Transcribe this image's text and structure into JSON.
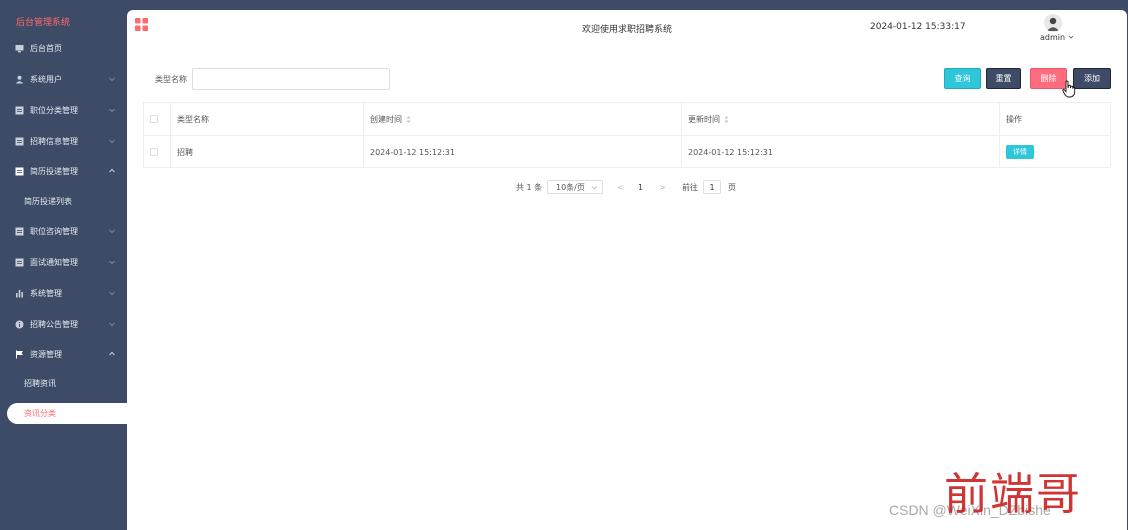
{
  "sidebar": {
    "title": "后台管理系统",
    "items": [
      {
        "label": "后台首页",
        "icon": "monitor-icon"
      },
      {
        "label": "系统用户",
        "icon": "user-icon"
      },
      {
        "label": "职位分类管理",
        "icon": "list-icon"
      },
      {
        "label": "招聘信息管理",
        "icon": "list-icon"
      },
      {
        "label": "简历投递管理",
        "icon": "list-icon"
      },
      {
        "label": "职位咨询管理",
        "icon": "list-icon"
      },
      {
        "label": "面试通知管理",
        "icon": "list-icon"
      },
      {
        "label": "系统管理",
        "icon": "bar-chart-icon"
      },
      {
        "label": "招聘公告管理",
        "icon": "info-icon"
      },
      {
        "label": "资源管理",
        "icon": "flag-icon"
      }
    ],
    "sub_resume": "简历投递列表",
    "sub_resource_1": "招聘资讯",
    "sub_resource_active": "资讯分类"
  },
  "header": {
    "welcome": "欢迎使用求职招聘系统",
    "datetime": "2024-01-12 15:33:17",
    "username": "admin"
  },
  "filter": {
    "label": "类型名称",
    "value": "",
    "placeholder": ""
  },
  "buttons": {
    "query": "查询",
    "reset": "重置",
    "delete": "删除",
    "add": "添加"
  },
  "table": {
    "headers": [
      "类型名称",
      "创建时间",
      "更新时间",
      "操作"
    ],
    "rows": [
      {
        "name": "招聘",
        "created": "2024-01-12 15:12:31",
        "updated": "2024-01-12 15:12:31",
        "action": "详情"
      }
    ]
  },
  "pagination": {
    "total": "共 1 条",
    "page_size": "10条/页",
    "prev": "<",
    "current": "1",
    "next": ">",
    "goto": "前往",
    "goto_value": "1",
    "page_unit": "页"
  },
  "watermark": {
    "big": "前端哥",
    "small": "CSDN @WeiXin_DZbishe"
  },
  "colors": {
    "sidebar_bg": "#3d4b66",
    "accent_red": "#ff6b6b",
    "query_btn": "#2ec6d9",
    "delete_btn": "#ff6b7f"
  }
}
